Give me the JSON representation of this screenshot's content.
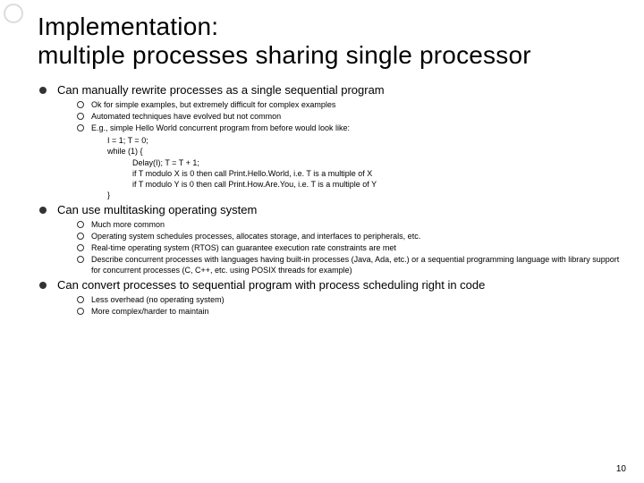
{
  "title": "Implementation:\nmultiple processes sharing single processor",
  "bullets": [
    {
      "text": "Can manually rewrite processes as a single sequential program",
      "sub": [
        "Ok for simple examples, but extremely difficult for complex examples",
        "Automated techniques have evolved but not common",
        "E.g., simple Hello World concurrent program from before would look like:"
      ],
      "code": [
        {
          "indent": 1,
          "line": "I = 1; T = 0;"
        },
        {
          "indent": 1,
          "line": "while (1) {"
        },
        {
          "indent": 2,
          "line": "Delay(I); T = T + 1;"
        },
        {
          "indent": 2,
          "line": "if T modulo X is 0 then call Print.Hello.World, i.e. T is a multiple of X"
        },
        {
          "indent": 2,
          "line": "if T modulo Y is 0 then call Print.How.Are.You, i.e. T is a multiple of Y"
        },
        {
          "indent": 1,
          "line": "}"
        }
      ]
    },
    {
      "text": "Can use multitasking operating system",
      "sub": [
        "Much more common",
        "Operating system schedules processes, allocates storage, and interfaces to peripherals, etc.",
        "Real-time operating system (RTOS) can guarantee execution rate constraints are met",
        "Describe concurrent processes with languages having built-in processes (Java, Ada, etc.) or a sequential programming language with library support for concurrent processes (C, C++, etc. using POSIX threads for example)"
      ]
    },
    {
      "text": "Can convert processes to sequential program with process scheduling right in code",
      "sub": [
        "Less overhead (no operating system)",
        "More complex/harder to maintain"
      ]
    }
  ],
  "page_number": "10"
}
